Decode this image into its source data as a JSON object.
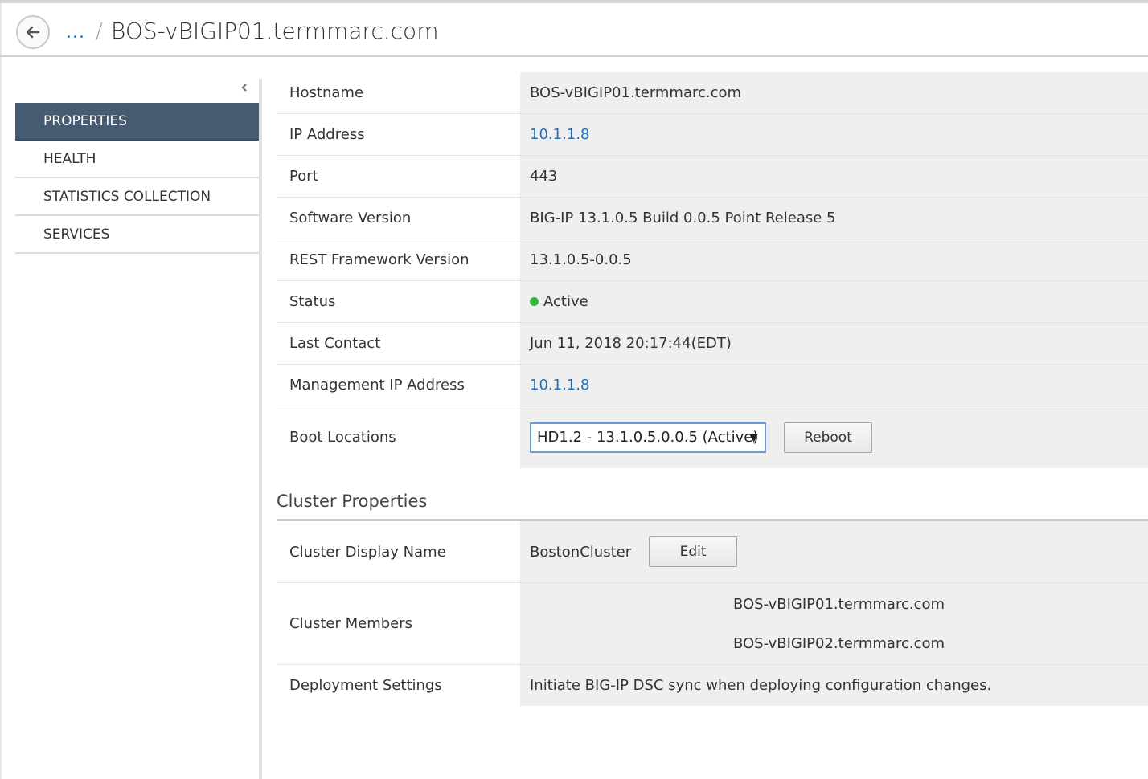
{
  "header": {
    "breadcrumb_ellipsis": "...",
    "breadcrumb_separator": "/",
    "title": "BOS-vBIGIP01.termmarc.com"
  },
  "sidebar": {
    "items": [
      {
        "label": "PROPERTIES",
        "active": true
      },
      {
        "label": "HEALTH",
        "active": false
      },
      {
        "label": "STATISTICS COLLECTION",
        "active": false
      },
      {
        "label": "SERVICES",
        "active": false
      }
    ]
  },
  "properties": {
    "hostname": {
      "label": "Hostname",
      "value": "BOS-vBIGIP01.termmarc.com"
    },
    "ip_address": {
      "label": "IP Address",
      "value": "10.1.1.8"
    },
    "port": {
      "label": "Port",
      "value": "443"
    },
    "software_version": {
      "label": "Software Version",
      "value": "BIG-IP 13.1.0.5 Build 0.0.5 Point Release 5"
    },
    "rest_version": {
      "label": "REST Framework Version",
      "value": "13.1.0.5-0.0.5"
    },
    "status": {
      "label": "Status",
      "value": "Active",
      "color": "#35b83c"
    },
    "last_contact": {
      "label": "Last Contact",
      "value": "Jun 11, 2018 20:17:44(EDT)"
    },
    "mgmt_ip": {
      "label": "Management IP Address",
      "value": "10.1.1.8"
    },
    "boot_locations": {
      "label": "Boot Locations",
      "selected": "HD1.2 - 13.1.0.5.0.0.5 (Active)",
      "reboot_label": "Reboot"
    }
  },
  "cluster": {
    "section_title": "Cluster Properties",
    "display_name": {
      "label": "Cluster Display Name",
      "value": "BostonCluster",
      "edit_label": "Edit"
    },
    "members": {
      "label": "Cluster Members",
      "values": [
        "BOS-vBIGIP01.termmarc.com",
        "BOS-vBIGIP02.termmarc.com"
      ]
    },
    "deployment": {
      "label": "Deployment Settings",
      "value": "Initiate BIG-IP DSC sync when deploying configuration changes."
    }
  },
  "colors": {
    "nav_active_bg": "#465a72",
    "link": "#1f6fb7",
    "value_bg": "#efefef"
  }
}
